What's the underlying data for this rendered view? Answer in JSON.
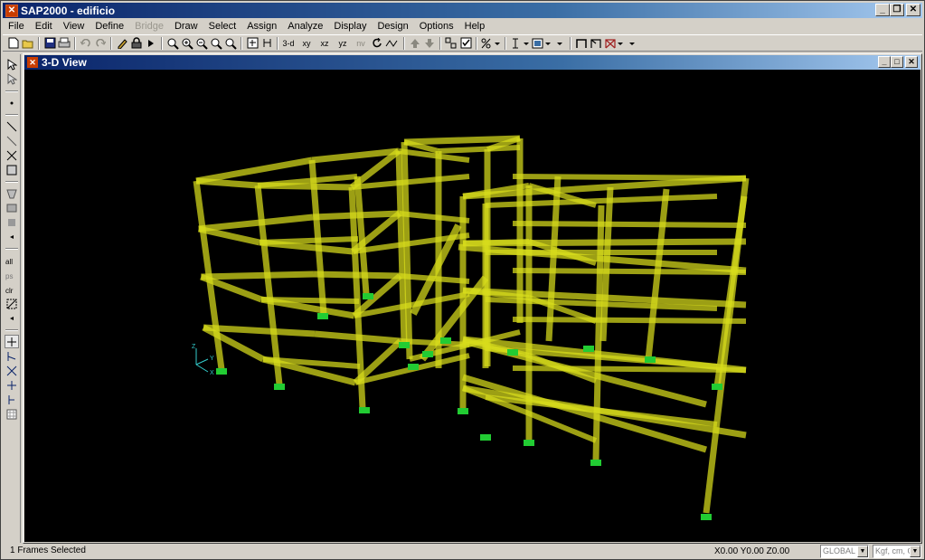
{
  "window": {
    "title": "SAP2000 - edificio",
    "app_icon_glyph": "✕",
    "min_glyph": "_",
    "restore_glyph": "❐",
    "close_glyph": "✕"
  },
  "menu": [
    "File",
    "Edit",
    "View",
    "Define",
    "Bridge",
    "Draw",
    "Select",
    "Assign",
    "Analyze",
    "Display",
    "Design",
    "Options",
    "Help"
  ],
  "menu_disabled": [
    "Bridge"
  ],
  "toolbar": {
    "view_3d": "3-d",
    "view_xy": "xy",
    "view_xz": "xz",
    "view_yz": "yz",
    "view_nv": "nv"
  },
  "view": {
    "title": "3-D View",
    "background": "#000000",
    "frame_color": "#d8dc1c",
    "support_color": "#22cc33",
    "axis_color": "#33cccc",
    "axis_labels": {
      "z": "Z",
      "y": "Y",
      "x": "X"
    }
  },
  "status": {
    "selection": "1 Frames Selected",
    "coords": "X0.00  Y0.00  Z0.00",
    "coord_system": "GLOBAL",
    "units": "Kgf, cm, C"
  },
  "icons": [
    "app-logo-icon",
    "new-file-icon",
    "open-file-icon",
    "save-icon",
    "print-icon",
    "undo-icon",
    "redo-icon",
    "pencil-icon",
    "lock-icon",
    "run-icon",
    "zoom-window-icon",
    "zoom-in-icon",
    "zoom-out-icon",
    "pan-icon",
    "refresh-icon",
    "rotate-icon",
    "perspective-icon",
    "up-arrow-icon",
    "down-arrow-icon",
    "select-pointer-icon"
  ]
}
